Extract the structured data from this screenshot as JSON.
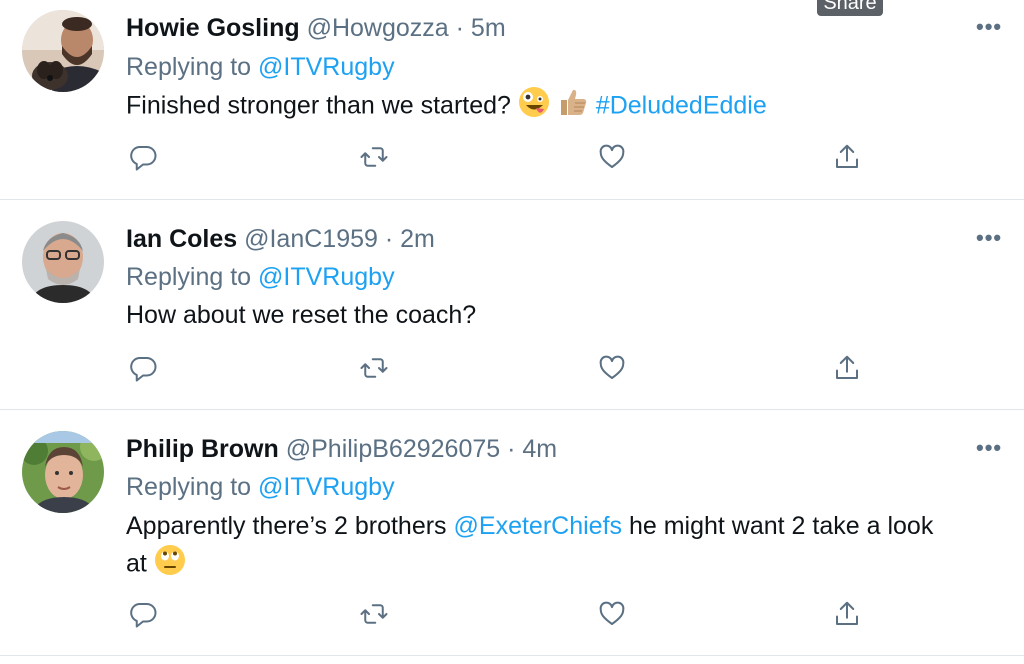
{
  "tooltip": {
    "label": "Share"
  },
  "tweets": [
    {
      "name": "Howie Gosling",
      "handle": "@Howgozza",
      "separator": "·",
      "time": "5m",
      "replying_prefix": "Replying to",
      "replying_to": "@ITVRugby",
      "text_before": "Finished stronger than we started?",
      "hashtag": "#DeludedEddie",
      "emojis": [
        "zany-face",
        "thumbs-up"
      ],
      "more": "•••"
    },
    {
      "name": "Ian Coles",
      "handle": "@IanC1959",
      "separator": "·",
      "time": "2m",
      "replying_prefix": "Replying to",
      "replying_to": "@ITVRugby",
      "text": "How about we reset the coach?",
      "more": "•••"
    },
    {
      "name": "Philip Brown",
      "handle": "@PhilipB62926075",
      "separator": "·",
      "time": "4m",
      "replying_prefix": "Replying to",
      "replying_to": "@ITVRugby",
      "text_before": "Apparently there’s 2 brothers",
      "mention": "@ExeterChiefs",
      "text_after": "he might want 2 take a look",
      "text_line2": "at",
      "emojis": [
        "eye-roll-face"
      ],
      "more": "•••"
    }
  ],
  "action_icons": [
    "reply-icon",
    "retweet-icon",
    "like-icon",
    "share-icon"
  ],
  "colors": {
    "link": "#1da1f2",
    "secondary": "#5b7083",
    "text": "#0f1419",
    "divider": "#e2e6ea"
  }
}
